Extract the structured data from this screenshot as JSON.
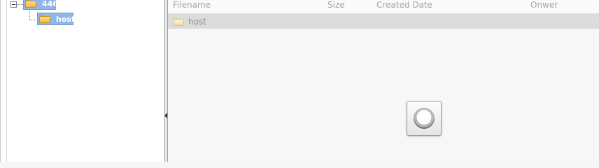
{
  "tree": {
    "root": {
      "label": "446",
      "icon": "folder-icon"
    },
    "child": {
      "label": "host",
      "icon": "folder-icon"
    }
  },
  "list": {
    "columns": [
      "Filename",
      "Size",
      "Created Date",
      "Onwer"
    ],
    "rows": [
      {
        "name": "host",
        "icon": "folder-icon"
      }
    ]
  },
  "loader": {
    "icon": "loading-spinner-icon"
  },
  "colors": {
    "selection": "#90b7e8",
    "row_highlight": "#dcdcdc",
    "header_text": "#a6a6a6"
  }
}
